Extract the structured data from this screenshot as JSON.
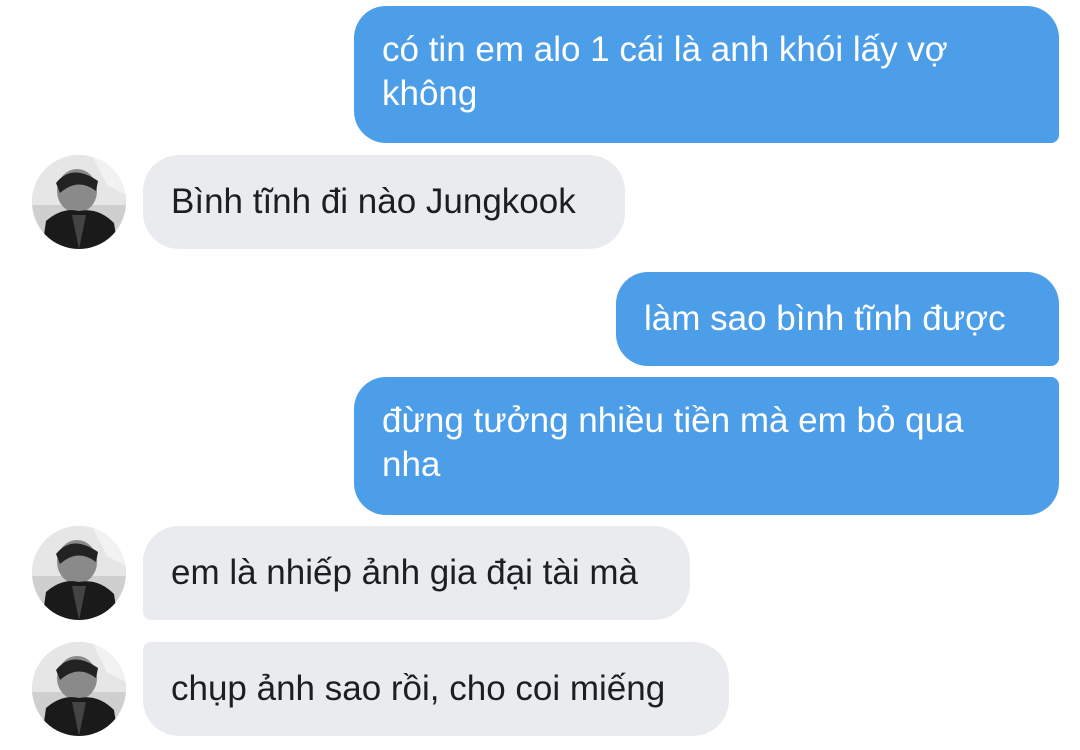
{
  "messages": [
    {
      "side": "sent",
      "text": "có tin em alo 1 cái là anh khói lấy vợ không"
    },
    {
      "side": "received",
      "text": "Bình tĩnh đi nào Jungkook"
    },
    {
      "side": "sent",
      "text": "làm sao bình tĩnh được"
    },
    {
      "side": "sent",
      "text": "đừng tưởng nhiều tiền mà em bỏ qua nha"
    },
    {
      "side": "received",
      "text": "em là nhiếp ảnh gia đại tài mà"
    },
    {
      "side": "received",
      "text": "chụp ảnh sao rồi, cho coi miếng"
    }
  ],
  "colors": {
    "sent_bubble": "#4c9ee8",
    "received_bubble": "#e9ebee",
    "background": "#ffffff"
  },
  "contact": {
    "avatar_icon": "user-avatar-photo-icon"
  }
}
